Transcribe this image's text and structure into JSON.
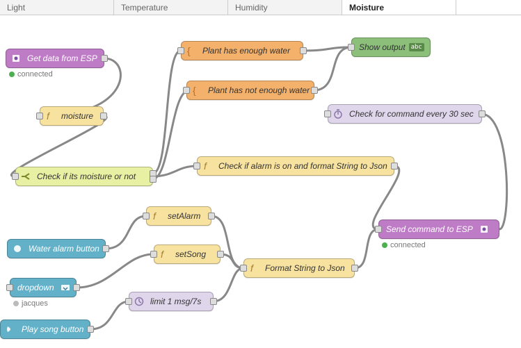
{
  "tabs": [
    {
      "label": "Light",
      "active": false
    },
    {
      "label": "Temperature",
      "active": false
    },
    {
      "label": "Humidity",
      "active": false
    },
    {
      "label": "Moisture",
      "active": true
    }
  ],
  "nodes": {
    "getData": {
      "label": "Get data from ESP",
      "status_text": "connected",
      "status_color": "green"
    },
    "moisture": {
      "label": "moisture"
    },
    "checkMoist": {
      "label": "Check if its moisture or not"
    },
    "plantEnough": {
      "label": "Plant has enough water"
    },
    "plantNot": {
      "label": "Plant has not enough water"
    },
    "showOutput": {
      "label": "Show output",
      "badge": "abc"
    },
    "checkCmd": {
      "label": "Check for command every 30 sec"
    },
    "checkAlarm": {
      "label": "Check if alarm is on and format String to Json"
    },
    "waterBtn": {
      "label": "Water alarm button"
    },
    "dropdown": {
      "label": "dropdown",
      "status_text": "jacques",
      "status_color": "grey"
    },
    "playBtn": {
      "label": "Play song button"
    },
    "setAlarm": {
      "label": "setAlarm"
    },
    "setSong": {
      "label": "setSong"
    },
    "limit": {
      "label": "limit 1 msg/7s"
    },
    "formatJson": {
      "label": "Format String to Json"
    },
    "sendCmd": {
      "label": "Send command to ESP",
      "status_text": "connected",
      "status_color": "green"
    }
  }
}
